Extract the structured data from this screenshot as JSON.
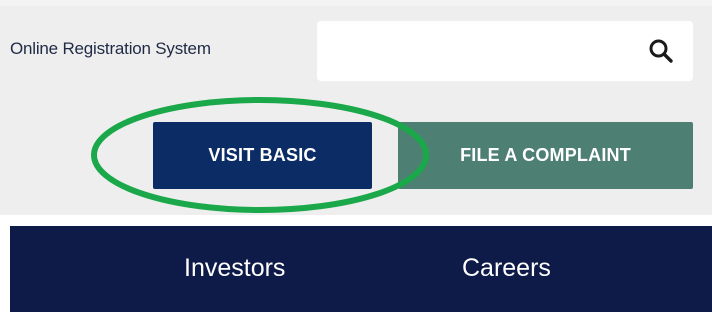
{
  "header": {
    "ors_link_label": "Online Registration System",
    "search": {
      "value": "",
      "placeholder": "",
      "icon": "search-icon"
    }
  },
  "actions": {
    "visit_basic_label": "VISIT BASIC",
    "file_complaint_label": "FILE A COMPLAINT"
  },
  "nav": {
    "items": [
      {
        "label": "Investors"
      },
      {
        "label": "Careers"
      }
    ]
  },
  "colors": {
    "top_band": "#eeeeee",
    "visit_basic_bg": "#0c2c66",
    "file_complaint_bg": "#4e7f73",
    "nav_bg": "#0e1a47",
    "highlight_ellipse": "#1aa84a"
  }
}
